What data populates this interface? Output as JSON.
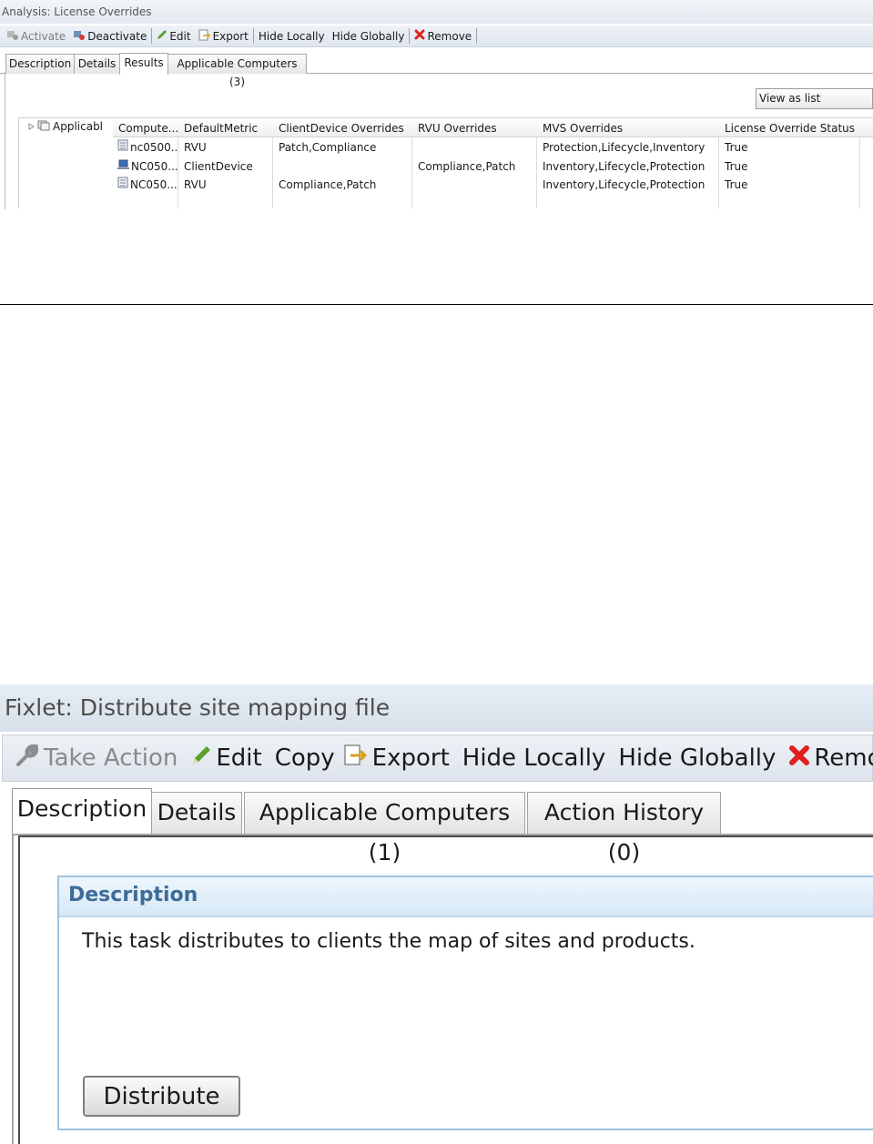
{
  "analysis": {
    "title": "Analysis: License Overrides",
    "toolbar": {
      "activate": "Activate",
      "deactivate": "Deactivate",
      "edit": "Edit",
      "export": "Export",
      "hide_locally": "Hide Locally",
      "hide_globally": "Hide Globally",
      "remove": "Remove"
    },
    "tabs": [
      "Description",
      "Details",
      "Results",
      "Applicable Computers (3)"
    ],
    "active_tab": "Results",
    "view_as": "View as list",
    "tree_label": "Applicabl",
    "columns": [
      "Compute...",
      "DefaultMetric",
      "ClientDevice Overrides",
      "RVU Overrides",
      "MVS Overrides",
      "License Override Status"
    ],
    "rows": [
      {
        "computer": "nc0500...",
        "icon": "server-icon",
        "metric": "RVU",
        "clientdevice": "Patch,Compliance",
        "rvu": "",
        "mvs": "Protection,Lifecycle,Inventory",
        "status": "True"
      },
      {
        "computer": "NC050...",
        "icon": "laptop-icon",
        "metric": "ClientDevice",
        "clientdevice": "",
        "rvu": "Compliance,Patch",
        "mvs": "Inventory,Lifecycle,Protection",
        "status": "True"
      },
      {
        "computer": "NC050...",
        "icon": "server-icon",
        "metric": "RVU",
        "clientdevice": "Compliance,Patch",
        "rvu": "",
        "mvs": "Inventory,Lifecycle,Protection",
        "status": "True"
      }
    ]
  },
  "fixlet": {
    "title": "Fixlet: Distribute site mapping file",
    "toolbar": {
      "take_action": "Take Action",
      "edit": "Edit",
      "copy": "Copy",
      "export": "Export",
      "hide_locally": "Hide Locally",
      "hide_globally": "Hide Globally",
      "remove": "Remove"
    },
    "tabs": [
      "Description",
      "Details",
      "Applicable Computers (1)",
      "Action History (0)"
    ],
    "active_tab": "Description",
    "section_title": "Description",
    "description": "This task distributes to clients the map of sites and products.",
    "distribute_button": "Distribute"
  },
  "colors": {
    "remove_icon": "#e02020",
    "section_header_text": "#3e6c97",
    "section_border": "#9ec3df"
  }
}
